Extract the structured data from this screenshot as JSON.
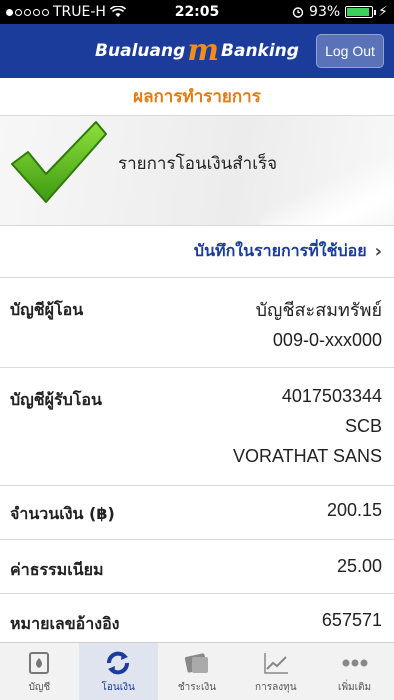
{
  "status_bar": {
    "carrier": "TRUE-H",
    "time": "22:05",
    "battery": "93%",
    "battery_level": 0.93
  },
  "header": {
    "brand_left": "Bualuang",
    "brand_mark": "m",
    "brand_right": "Banking",
    "logout_label": "Log Out"
  },
  "page_title": "ผลการทำรายการ",
  "banner": {
    "message": "รายการโอนเงินสำเร็จ",
    "icon": "checkmark-icon"
  },
  "favorite_link": "บันทึกในรายการที่ใช้บ่อย",
  "details": {
    "from": {
      "label": "บัญชีผู้โอน",
      "account_name": "บัญชีสะสมทรัพย์",
      "account_no": "009-0-xxx000"
    },
    "to": {
      "label": "บัญชีผู้รับโอน",
      "account_no": "4017503344",
      "bank": "SCB",
      "name": "VORATHAT SANS"
    },
    "amount": {
      "label": "จำนวนเงิน (฿)",
      "value": "200.15"
    },
    "fee": {
      "label": "ค่าธรรมเนียม",
      "value": "25.00"
    },
    "reference": {
      "label": "หมายเลขอ้างอิง",
      "value": "657571"
    }
  },
  "tabs": [
    {
      "label": "บัญชี",
      "icon": "account-icon"
    },
    {
      "label": "โอนเงิน",
      "icon": "transfer-icon"
    },
    {
      "label": "ชำระเงิน",
      "icon": "payment-icon"
    },
    {
      "label": "การลงทุน",
      "icon": "investment-icon"
    },
    {
      "label": "เพิ่มเติม",
      "icon": "more-icon"
    }
  ],
  "colors": {
    "header_blue": "#1b3c9a",
    "title_orange": "#e27c13",
    "check_green": "#5cbf1e"
  }
}
